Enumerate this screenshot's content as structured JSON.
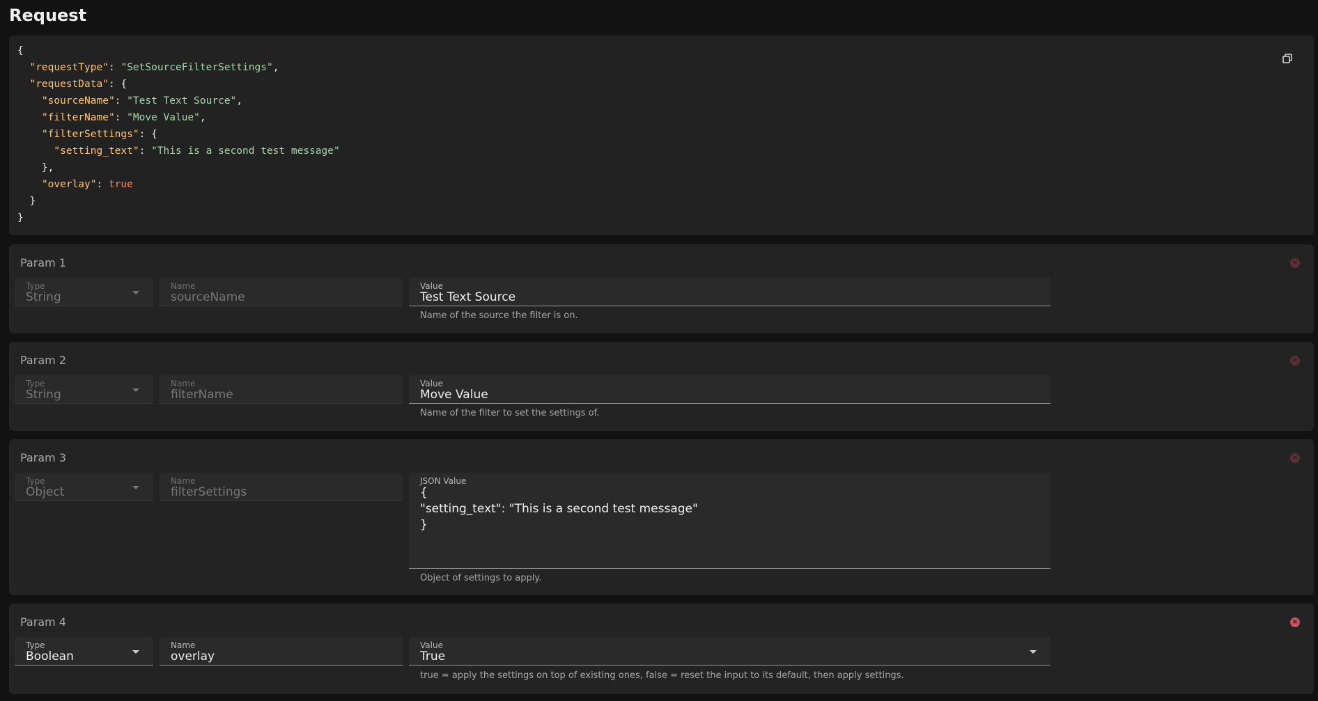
{
  "page": {
    "title": "Request"
  },
  "request_json": {
    "open_brace": "{",
    "request_type_key": "\"requestType\"",
    "request_type_value": "\"SetSourceFilterSettings\"",
    "request_data_key": "\"requestData\"",
    "source_name_key": "\"sourceName\"",
    "source_name_value": "\"Test Text Source\"",
    "filter_name_key": "\"filterName\"",
    "filter_name_value": "\"Move Value\"",
    "filter_settings_key": "\"filterSettings\"",
    "setting_text_key": "\"setting_text\"",
    "setting_text_value": "\"This is a second test message\"",
    "overlay_key": "\"overlay\"",
    "overlay_value": "true",
    "close_brace": "}",
    "copy_icon": "copy-icon"
  },
  "params": [
    {
      "title": "Param 1",
      "type_label": "Type",
      "type_value": "String",
      "name_label": "Name",
      "name_value": "sourceName",
      "value_label": "Value",
      "value": "Test Text Source",
      "description": "Name of the source the filter is on."
    },
    {
      "title": "Param 2",
      "type_label": "Type",
      "type_value": "String",
      "name_label": "Name",
      "name_value": "filterName",
      "value_label": "Value",
      "value": "Move Value",
      "description": "Name of the filter to set the settings of."
    },
    {
      "title": "Param 3",
      "type_label": "Type",
      "type_value": "Object",
      "name_label": "Name",
      "name_value": "filterSettings",
      "value_label": "JSON Value",
      "value": "{\n\"setting_text\": \"This is a second test message\"\n}",
      "description": "Object of settings to apply."
    },
    {
      "title": "Param 4",
      "type_label": "Type",
      "type_value": "Boolean",
      "name_label": "Name",
      "name_value": "overlay",
      "value_label": "Value",
      "value": "True",
      "description": "true = apply the settings on top of existing ones, false = reset the input to its default, then apply settings."
    }
  ],
  "colors": {
    "background": "#121212",
    "card": "#232323",
    "json_key": "#ffc66d",
    "json_string": "#a5d6a7",
    "json_boolean": "#ff8a50",
    "remove_icon": "#c8525d"
  }
}
